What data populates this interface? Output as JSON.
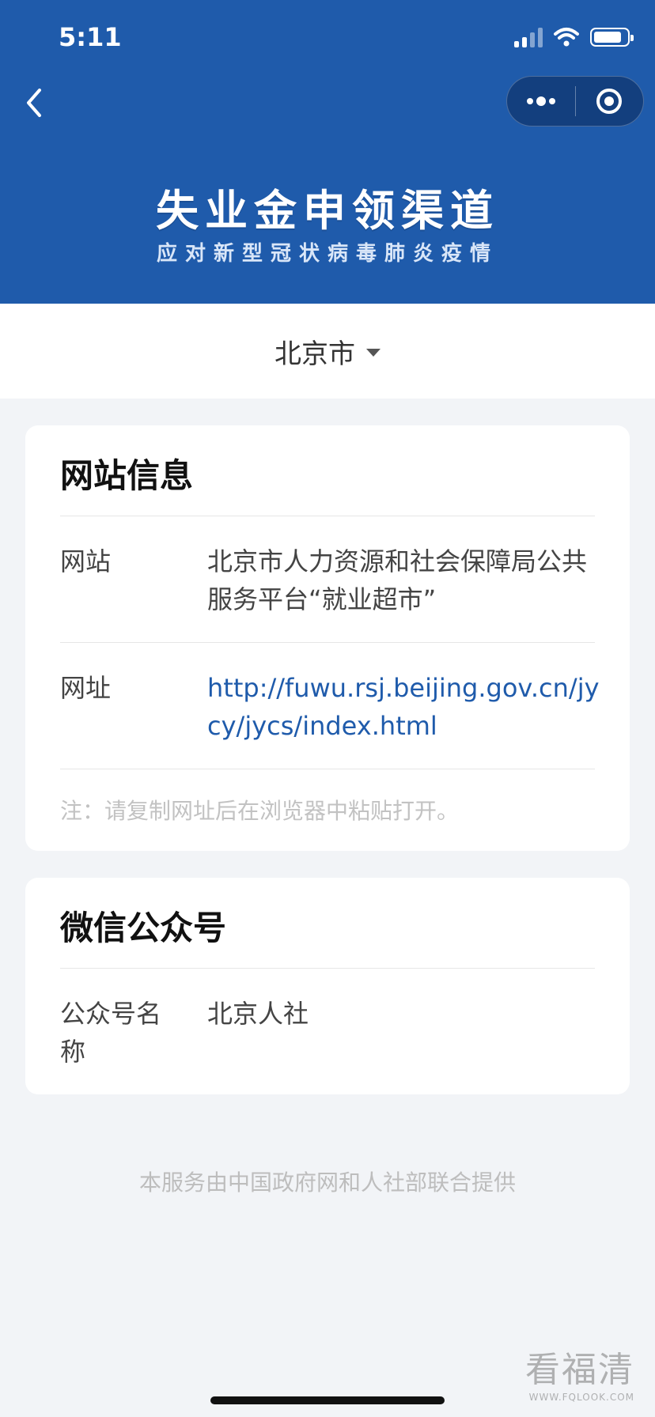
{
  "status_bar": {
    "time": "5:11"
  },
  "banner": {
    "title": "失业金申领渠道",
    "subtitle": "应对新型冠状病毒肺炎疫情"
  },
  "city_selector": {
    "city": "北京市"
  },
  "website_card": {
    "title": "网站信息",
    "site_label": "网站",
    "site_value": "北京市人力资源和社会保障局公共服务平台“就业超市”",
    "url_label": "网址",
    "url_value": "http://fuwu.rsj.beijing.gov.cn/jycy/jycs/index.html",
    "note": "注：请复制网址后在浏览器中粘贴打开。"
  },
  "wechat_card": {
    "title": "微信公众号",
    "account_label": "公众号名称",
    "account_value": "北京人社"
  },
  "footer": {
    "text": "本服务由中国政府网和人社部联合提供"
  },
  "watermark": {
    "main": "看福清",
    "sub": "WWW.FQLOOK.COM"
  },
  "colors": {
    "header_bg": "#1f5bab",
    "link": "#1f5bab",
    "page_bg": "#f2f4f7"
  },
  "icons": [
    "back-arrow-icon",
    "more-dots-icon",
    "close-target-icon",
    "caret-down-icon",
    "signal-icon",
    "wifi-icon",
    "battery-icon"
  ]
}
